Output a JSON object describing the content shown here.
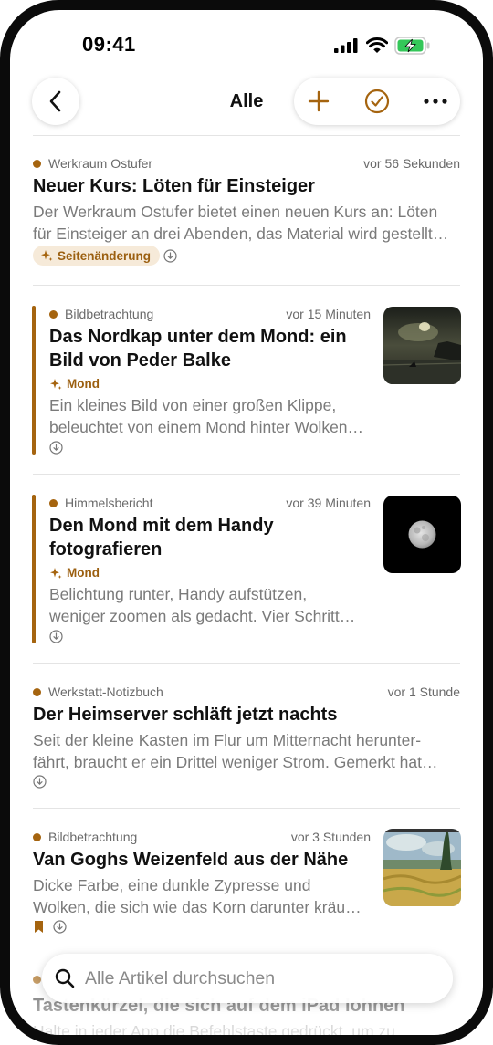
{
  "status": {
    "time": "09:41"
  },
  "nav": {
    "title": "Alle"
  },
  "articles": [
    {
      "source": "Werkraum Ostufer",
      "time": "vor 56 Sekunden",
      "title_lines": [
        "Neuer Kurs: Löten für Einsteiger"
      ],
      "excerpt_lines": [
        "Der Werkraum Ostufer bietet einen neuen Kurs an: Löten",
        "für Einsteiger an drei Abenden, das Material wird gestellt…"
      ],
      "tag": "Seitenänderung"
    },
    {
      "source": "Bildbetrachtung",
      "time": "vor 15 Minuten",
      "title_lines": [
        "Das Nordkap unter dem Mond: ein",
        "Bild von Peder Balke"
      ],
      "tag": "Mond",
      "excerpt_lines": [
        "Ein kleines Bild von einer großen Klippe,",
        "beleuchtet von einem Mond hinter Wolken…"
      ]
    },
    {
      "source": "Himmelsbericht",
      "time": "vor 39 Minuten",
      "title_lines": [
        "Den Mond mit dem Handy",
        "fotografieren"
      ],
      "tag": "Mond",
      "excerpt_lines": [
        "Belichtung runter, Handy aufstützen,",
        "weniger zoomen als gedacht. Vier Schritt…"
      ]
    },
    {
      "source": "Werkstatt-Notizbuch",
      "time": "vor 1 Stunde",
      "title_lines": [
        "Der Heimserver schläft jetzt nachts"
      ],
      "excerpt_lines": [
        "Seit der kleine Kasten im Flur um Mitternacht herunter-",
        "fährt, braucht er ein Drittel weniger Strom. Gemerkt hat…"
      ]
    },
    {
      "source": "Bildbetrachtung",
      "time": "vor 3 Stunden",
      "title_lines": [
        "Van Goghs Weizenfeld aus der Nähe"
      ],
      "excerpt_lines": [
        "Dicke Farbe, eine dunkle Zypresse und",
        "Wolken, die sich wie das Korn darunter kräu…"
      ]
    },
    {
      "title_lines": [
        "Tastenkürzel, die sich auf dem iPad lohnen"
      ],
      "excerpt_lines": [
        "Halte in jeder App die Befehlstaste gedrückt, um zu…"
      ]
    }
  ],
  "search": {
    "placeholder": "Alle Artikel durchsuchen"
  },
  "colors": {
    "accent": "#a5640f",
    "tag_bg": "#f6ead9"
  }
}
